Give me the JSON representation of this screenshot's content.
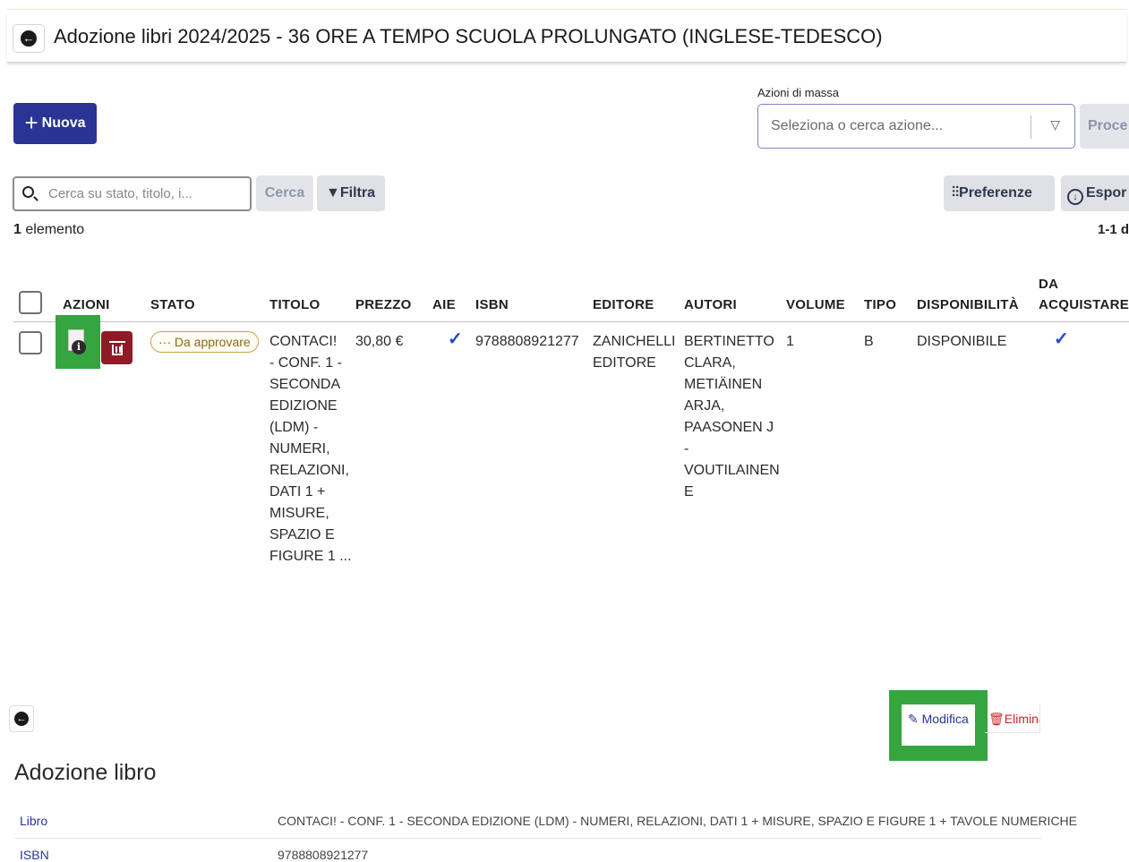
{
  "header": {
    "title": "Adozione libri 2024/2025 - 36 ORE A TEMPO SCUOLA PROLUNGATO (INGLESE-TEDESCO)"
  },
  "toolbar": {
    "new_label": "Nuova",
    "mass_actions_label": "Azioni di massa",
    "mass_actions_placeholder": "Seleziona o cerca azione...",
    "proceed_label": "Proce",
    "search_placeholder": "Cerca su stato, titolo, i...",
    "search_label": "Cerca",
    "filter_label": "Filtra",
    "preferences_label": "Preferenze",
    "export_label": "Espor"
  },
  "list": {
    "count": "1",
    "count_suffix": "elemento",
    "pager": "1-1 d"
  },
  "table": {
    "headers": {
      "azioni": "AZIONI",
      "stato": "STATO",
      "titolo": "TITOLO",
      "prezzo": "PREZZO",
      "aie": "AIE",
      "isbn": "ISBN",
      "editore": "EDITORE",
      "autori": "AUTORI",
      "volume": "VOLUME",
      "tipo": "TIPO",
      "disponibilita": "DISPONIBILITÀ",
      "da": "DA",
      "acquistare": "ACQUISTARE"
    },
    "rows": [
      {
        "stato": "··· Da approvare",
        "titolo": "CONTACI!\n- CONF. 1 -\nSECONDA\nEDIZIONE\n(LDM) -\nNUMERI,\nRELAZIONI,\nDATI 1 +\nMISURE,\nSPAZIO E\nFIGURE 1 ...",
        "prezzo": "30,80 €",
        "aie": true,
        "isbn": "9788808921277",
        "editore": "ZANICHELLI\nEDITORE",
        "autori": "BERTINETTO\nCLARA,\nMETIÄINEN\nARJA,\nPAASONEN J\n-\nVOUTILAINEN\nE",
        "volume": "1",
        "tipo": "B",
        "disponibilita": "DISPONIBILE",
        "da_acquistare": true
      }
    ]
  },
  "detail": {
    "title": "Adozione libro",
    "edit_label": "Modifica",
    "delete_label": "Elimina",
    "fields": [
      {
        "key": "Libro",
        "value": "CONTACI! - CONF. 1 - SECONDA EDIZIONE (LDM) - NUMERI, RELAZIONI, DATI 1 + MISURE, SPAZIO E FIGURE 1  + TAVOLE NUMERICHE"
      },
      {
        "key": "ISBN",
        "value": "9788808921277"
      }
    ]
  },
  "colors": {
    "primary": "#2a3494",
    "danger": "#8e1b26",
    "highlight": "#35a53f",
    "check": "#2347c9",
    "badge_border": "#c9a24a"
  }
}
